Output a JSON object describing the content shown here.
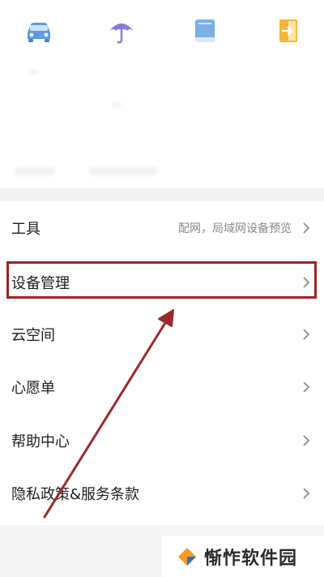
{
  "top_icons": [
    {
      "name": "car-icon",
      "color": "#5b9be0"
    },
    {
      "name": "umbrella-icon",
      "color": "#8e7bd6"
    },
    {
      "name": "book-icon",
      "color": "#7ab0e6"
    },
    {
      "name": "door-exit-icon",
      "color": "#f4b63a"
    }
  ],
  "menu": {
    "items": [
      {
        "label": "工具",
        "sublabel": "配网，局域网设备预览"
      },
      {
        "label": "设备管理",
        "sublabel": ""
      },
      {
        "label": "云空间",
        "sublabel": ""
      },
      {
        "label": "心愿单",
        "sublabel": ""
      },
      {
        "label": "帮助中心",
        "sublabel": ""
      },
      {
        "label": "隐私政策&服务条款",
        "sublabel": ""
      }
    ]
  },
  "annotation": {
    "highlight_color": "#a31f24",
    "arrow_color": "#9b2a2c"
  },
  "watermark": {
    "text": "惭怍软件园",
    "logo_colors": [
      "#f59a23",
      "#2b6fd6"
    ]
  }
}
